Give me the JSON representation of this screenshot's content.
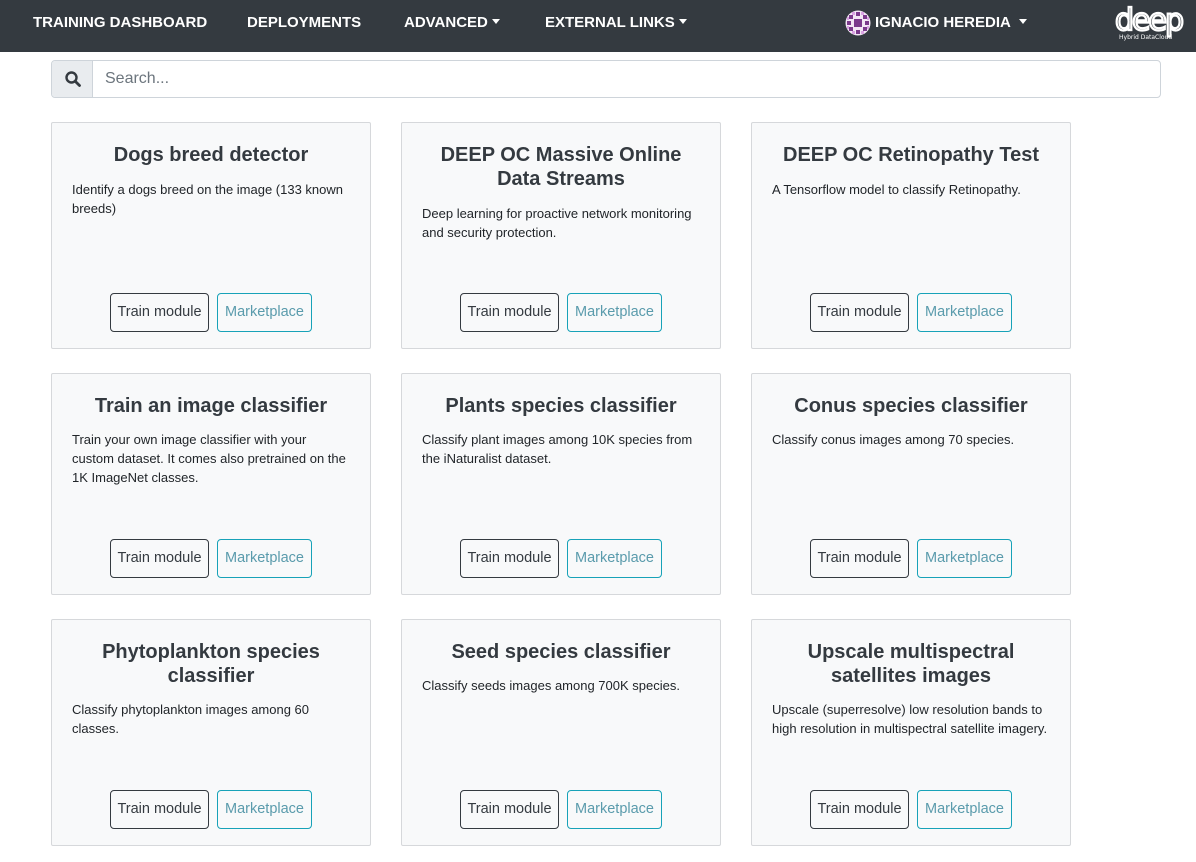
{
  "navbar": {
    "items": [
      {
        "label": "TRAINING DASHBOARD"
      },
      {
        "label": "DEPLOYMENTS"
      },
      {
        "label": "ADVANCED"
      },
      {
        "label": "EXTERNAL LINKS"
      }
    ],
    "user": {
      "name": "IGNACIO HEREDIA"
    },
    "logo": {
      "wordmark": "deep",
      "tagline": "Hybrid DataCloud"
    }
  },
  "search": {
    "placeholder": "Search..."
  },
  "cards": [
    {
      "title": "Dogs breed detector",
      "description": "Identify a dogs breed on the image (133 known breeds)",
      "train_label": "Train module",
      "marketplace_label": "Marketplace"
    },
    {
      "title": "DEEP OC Massive Online Data Streams",
      "description": "Deep learning for proactive network monitoring and security protection.",
      "train_label": "Train module",
      "marketplace_label": "Marketplace"
    },
    {
      "title": "DEEP OC Retinopathy Test",
      "description": "A Tensorflow model to classify Retinopathy.",
      "train_label": "Train module",
      "marketplace_label": "Marketplace"
    },
    {
      "title": "Train an image classifier",
      "description": "Train your own image classifier with your custom dataset. It comes also pretrained on the 1K ImageNet classes.",
      "train_label": "Train module",
      "marketplace_label": "Marketplace"
    },
    {
      "title": "Plants species classifier",
      "description": "Classify plant images among 10K species from the iNaturalist dataset.",
      "train_label": "Train module",
      "marketplace_label": "Marketplace"
    },
    {
      "title": "Conus species classifier",
      "description": "Classify conus images among 70 species.",
      "train_label": "Train module",
      "marketplace_label": "Marketplace"
    },
    {
      "title": "Phytoplankton species classifier",
      "description": "Classify phytoplankton images among 60 classes.",
      "train_label": "Train module",
      "marketplace_label": "Marketplace"
    },
    {
      "title": "Seed species classifier",
      "description": "Classify seeds images among 700K species.",
      "train_label": "Train module",
      "marketplace_label": "Marketplace"
    },
    {
      "title": "Upscale multispectral satellites images",
      "description": "Upscale (superresolve) low resolution bands to high resolution in multispectral satellite imagery.",
      "train_label": "Train module",
      "marketplace_label": "Marketplace"
    }
  ],
  "colors": {
    "navbar_bg": "#343a40",
    "card_bg": "#f8f9fa",
    "accent_info": "#17a2b8"
  }
}
